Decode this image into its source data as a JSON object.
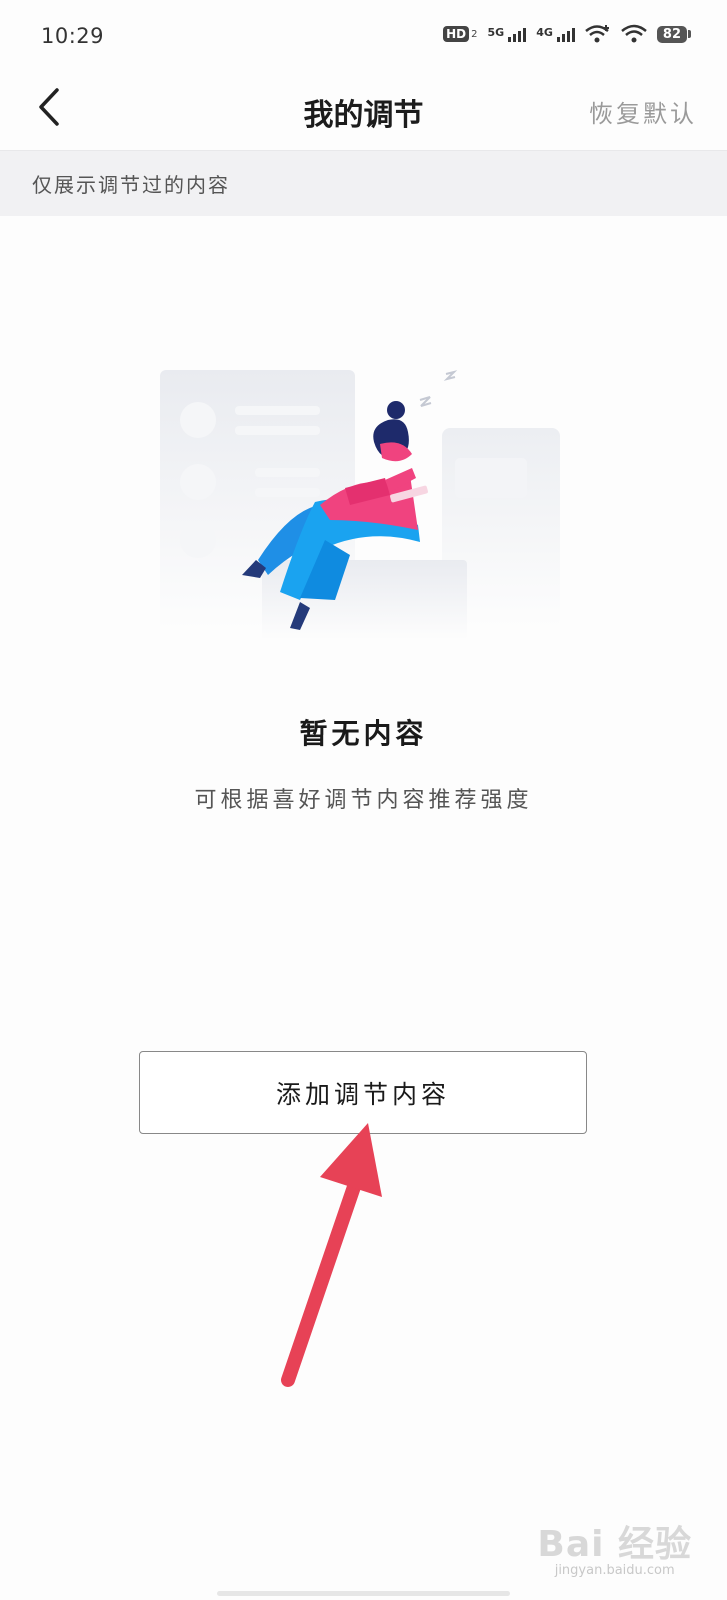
{
  "status_bar": {
    "time": "10:29",
    "hd_label": "HD",
    "hd_sub": "2",
    "signal_5g_label": "5G",
    "signal_4g_label": "4G",
    "battery_level": "82",
    "icons": [
      "hd-icon",
      "signal-5g-icon",
      "signal-4g-icon",
      "wifi-plus-icon",
      "wifi-icon",
      "battery-icon"
    ]
  },
  "header": {
    "back_icon": "chevron-left-icon",
    "title": "我的调节",
    "reset_label": "恢复默认"
  },
  "hint": {
    "text": "仅展示调节过的内容"
  },
  "empty_state": {
    "illustration": "person-lounging-illustration",
    "title": "暂无内容",
    "description": "可根据喜好调节内容推荐强度"
  },
  "actions": {
    "add_label": "添加调节内容"
  },
  "annotation": {
    "arrow_icon": "red-pointer-arrow",
    "color": "#e74256"
  },
  "watermark": {
    "logo": "Bai 经验",
    "url": "jingyan.baidu.com"
  }
}
